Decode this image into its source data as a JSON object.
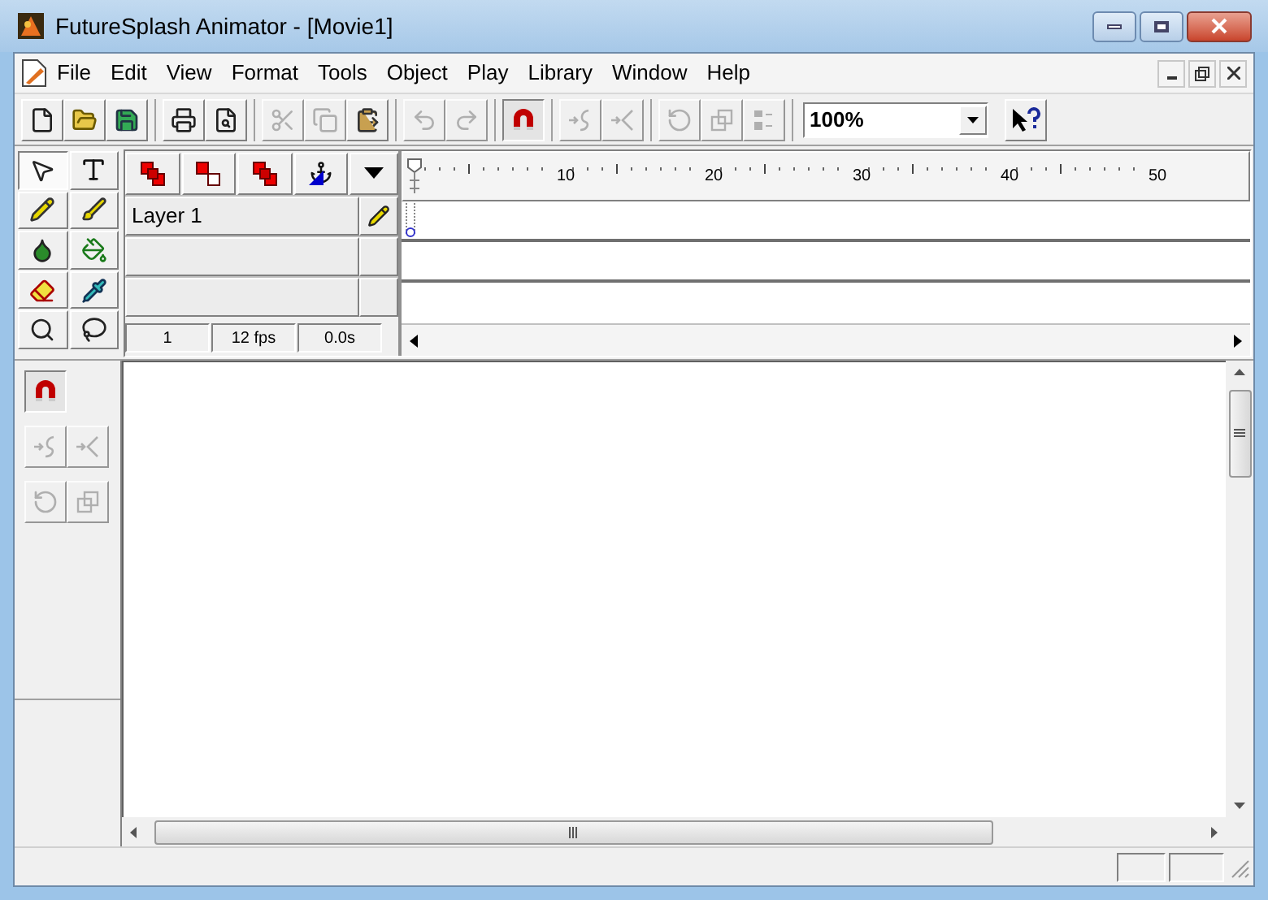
{
  "window": {
    "title": "FutureSplash Animator - [Movie1]"
  },
  "menu": [
    {
      "label": "File"
    },
    {
      "label": "Edit"
    },
    {
      "label": "View"
    },
    {
      "label": "Format"
    },
    {
      "label": "Tools"
    },
    {
      "label": "Object"
    },
    {
      "label": "Play"
    },
    {
      "label": "Library"
    },
    {
      "label": "Window"
    },
    {
      "label": "Help"
    }
  ],
  "toolbar": [
    {
      "kind": "new",
      "disabled": false,
      "pressed": false
    },
    {
      "kind": "open",
      "disabled": false,
      "pressed": false
    },
    {
      "kind": "save",
      "disabled": false,
      "pressed": false
    },
    {
      "kind": "sep"
    },
    {
      "kind": "print",
      "disabled": false,
      "pressed": false
    },
    {
      "kind": "preview",
      "disabled": false,
      "pressed": false
    },
    {
      "kind": "sep"
    },
    {
      "kind": "cut",
      "disabled": true,
      "pressed": false
    },
    {
      "kind": "copy",
      "disabled": true,
      "pressed": false
    },
    {
      "kind": "paste",
      "disabled": false,
      "pressed": false
    },
    {
      "kind": "sep"
    },
    {
      "kind": "undo",
      "disabled": true,
      "pressed": false
    },
    {
      "kind": "redo",
      "disabled": true,
      "pressed": false
    },
    {
      "kind": "sep"
    },
    {
      "kind": "magnet",
      "disabled": false,
      "pressed": true
    },
    {
      "kind": "sep"
    },
    {
      "kind": "smooth",
      "disabled": true,
      "pressed": false
    },
    {
      "kind": "straighten",
      "disabled": true,
      "pressed": false
    },
    {
      "kind": "sep"
    },
    {
      "kind": "rotate",
      "disabled": true,
      "pressed": false
    },
    {
      "kind": "scale",
      "disabled": true,
      "pressed": false
    },
    {
      "kind": "align",
      "disabled": true,
      "pressed": false
    },
    {
      "kind": "sep"
    }
  ],
  "zoom_box": {
    "value": "100%"
  },
  "tools": [
    {
      "kind": "arrow",
      "selected": true
    },
    {
      "kind": "text",
      "selected": false
    },
    {
      "kind": "pencil",
      "selected": false
    },
    {
      "kind": "brush",
      "selected": false
    },
    {
      "kind": "ink",
      "selected": false
    },
    {
      "kind": "bucket",
      "selected": false
    },
    {
      "kind": "eraser",
      "selected": false
    },
    {
      "kind": "dropper",
      "selected": false
    },
    {
      "kind": "zoom",
      "selected": false
    },
    {
      "kind": "lasso",
      "selected": false
    }
  ],
  "layer_buttons": [
    {
      "kind": "add"
    },
    {
      "kind": "outline"
    },
    {
      "kind": "delete"
    },
    {
      "kind": "anchor"
    }
  ],
  "timeline": {
    "ruler_labels": [
      "10",
      "20",
      "30",
      "40",
      "50"
    ],
    "layers": [
      {
        "name": "Layer 1",
        "current": true
      }
    ]
  },
  "status_fields": [
    "1",
    "12 fps",
    "0.0s"
  ],
  "modifiers": [
    {
      "kind": "magnet",
      "disabled": false,
      "pressed": true
    },
    {
      "kind": "smooth",
      "disabled": true,
      "pressed": false
    },
    {
      "kind": "straighten",
      "disabled": true,
      "pressed": false
    },
    {
      "kind": "rotate",
      "disabled": true,
      "pressed": false
    },
    {
      "kind": "scale",
      "disabled": true,
      "pressed": false
    }
  ]
}
